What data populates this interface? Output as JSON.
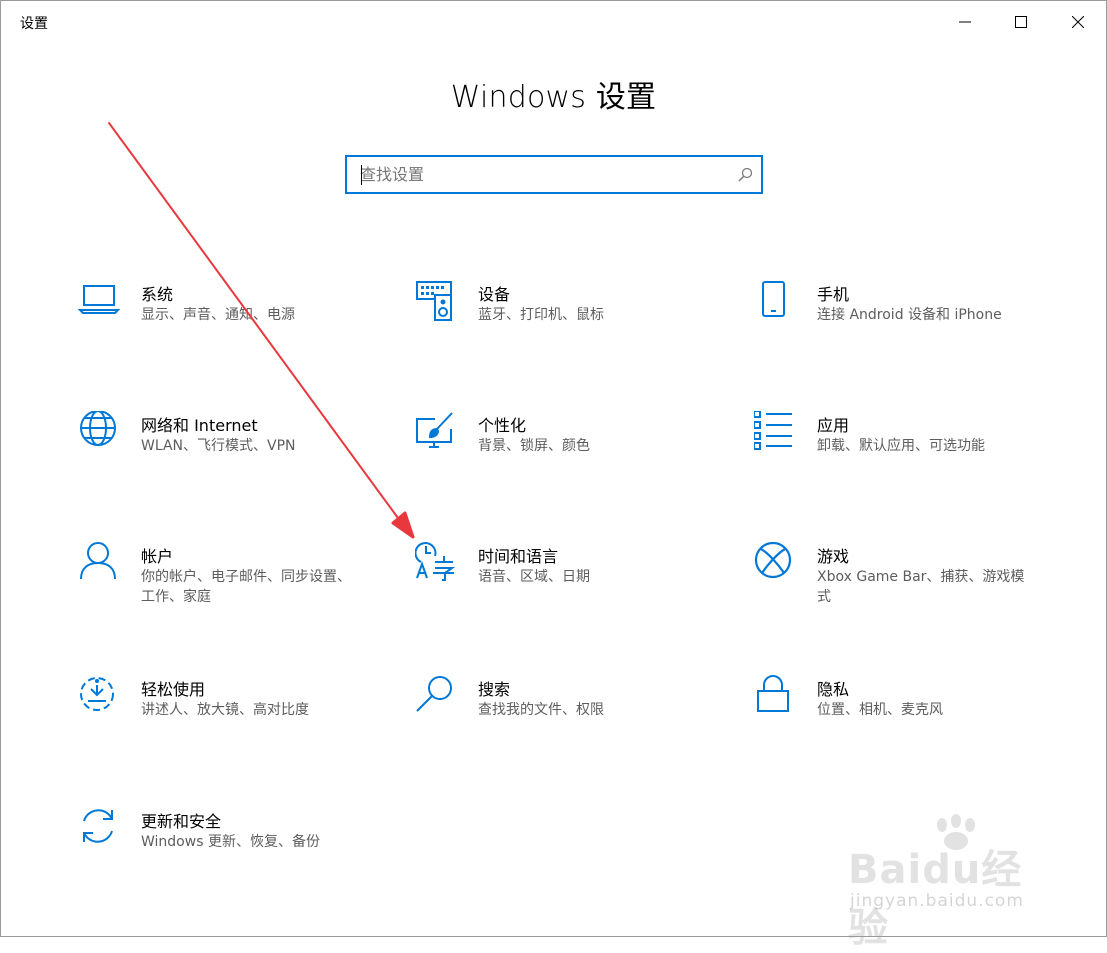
{
  "window": {
    "title": "设置",
    "controls": {
      "minimize": "minimize-icon",
      "maximize": "maximize-icon",
      "close": "close-icon"
    }
  },
  "page": {
    "title": "Windows 设置"
  },
  "search": {
    "placeholder": "查找设置",
    "value": "",
    "icon": "search-icon"
  },
  "accent_color": "#0078d7",
  "arrow_color": "#e8383d",
  "tiles": [
    {
      "name": "系统",
      "desc": "显示、声音、通知、电源",
      "icon": "laptop-icon"
    },
    {
      "name": "设备",
      "desc": "蓝牙、打印机、鼠标",
      "icon": "keyboard-speaker-icon"
    },
    {
      "name": "手机",
      "desc": "连接 Android 设备和 iPhone",
      "icon": "phone-icon"
    },
    {
      "name": "网络和 Internet",
      "desc": "WLAN、飞行模式、VPN",
      "icon": "globe-icon"
    },
    {
      "name": "个性化",
      "desc": "背景、锁屏、颜色",
      "icon": "paint-brush-icon"
    },
    {
      "name": "应用",
      "desc": "卸载、默认应用、可选功能",
      "icon": "app-list-icon"
    },
    {
      "name": "帐户",
      "desc": "你的帐户、电子邮件、同步设置、工作、家庭",
      "icon": "person-icon"
    },
    {
      "name": "时间和语言",
      "desc": "语音、区域、日期",
      "icon": "time-language-icon"
    },
    {
      "name": "游戏",
      "desc": "Xbox Game Bar、捕获、游戏模式",
      "icon": "xbox-icon"
    },
    {
      "name": "轻松使用",
      "desc": "讲述人、放大镜、高对比度",
      "icon": "ease-of-access-icon"
    },
    {
      "name": "搜索",
      "desc": "查找我的文件、权限",
      "icon": "magnifier-icon"
    },
    {
      "name": "隐私",
      "desc": "位置、相机、麦克风",
      "icon": "lock-icon"
    },
    {
      "name": "更新和安全",
      "desc": "Windows 更新、恢复、备份",
      "icon": "refresh-icon"
    }
  ],
  "watermark": {
    "brand": "Baidu经验",
    "url": "jingyan.baidu.com"
  }
}
